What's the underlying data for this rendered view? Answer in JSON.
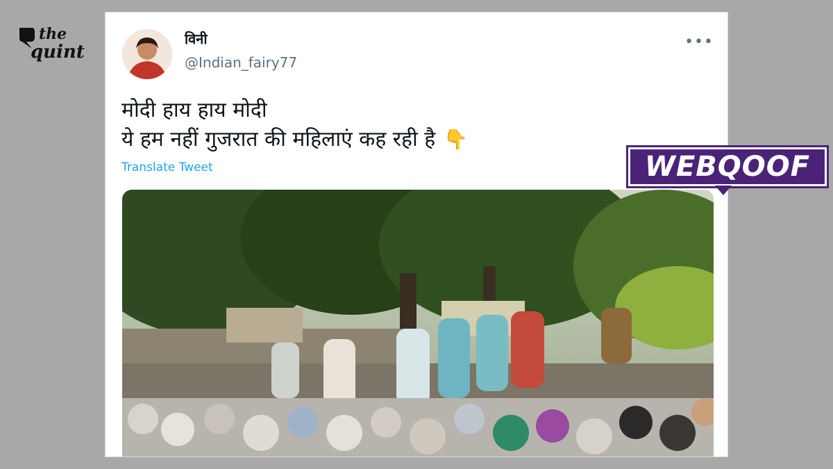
{
  "brand": {
    "line1": "the",
    "line2": "quint"
  },
  "tweet": {
    "display_name": "विनी",
    "handle": "@Indian_fairy77",
    "more_label": "•••",
    "text_line1": "मोदी हाय हाय मोदी",
    "text_line2": "ये हम नहीं गुजरात की महिलाएं कह रही है",
    "emoji": "👇",
    "translate_label": "Translate Tweet"
  },
  "badge": {
    "label": "WEBQOOF"
  },
  "colors": {
    "background": "#a8a8a8",
    "link": "#1da1f2",
    "badge": "#4a2378",
    "handle": "#5b7083"
  },
  "icons": [
    "quint-pin-icon",
    "more-options-icon",
    "pointing-down-emoji"
  ]
}
